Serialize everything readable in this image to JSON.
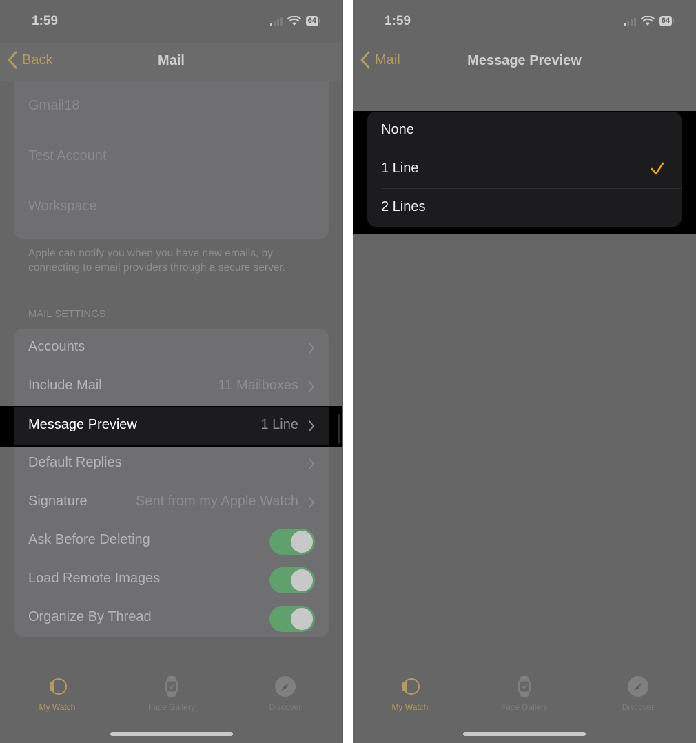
{
  "colors": {
    "accent": "#b59a62",
    "toggle_on": "#5fa06d",
    "checkmark": "#f0a020",
    "panel_bg": "#666666",
    "highlight_bg": "#1c1c1e"
  },
  "left": {
    "status": {
      "time": "1:59",
      "battery": "64"
    },
    "nav": {
      "back_label": "Back",
      "title": "Mail"
    },
    "accounts": [
      "Gmail18",
      "Test Account",
      "Workspace"
    ],
    "footer_note": "Apple can notify you when you have new emails, by connecting to email providers through a secure server.",
    "section_header": "MAIL SETTINGS",
    "settings": [
      {
        "label": "Accounts",
        "value": "",
        "type": "link"
      },
      {
        "label": "Include Mail",
        "value": "11 Mailboxes",
        "type": "link"
      },
      {
        "label": "Message Preview",
        "value": "1 Line",
        "type": "link",
        "highlighted": true
      },
      {
        "label": "Default Replies",
        "value": "",
        "type": "link"
      },
      {
        "label": "Signature",
        "value": "Sent from my Apple Watch",
        "type": "link"
      },
      {
        "label": "Ask Before Deleting",
        "type": "toggle",
        "on": true
      },
      {
        "label": "Load Remote Images",
        "type": "toggle",
        "on": true
      },
      {
        "label": "Organize By Thread",
        "type": "toggle",
        "on": true
      }
    ],
    "tabs": [
      {
        "label": "My Watch",
        "icon": "watch-side-icon",
        "active": true
      },
      {
        "label": "Face Gallery",
        "icon": "watch-face-icon",
        "active": false
      },
      {
        "label": "Discover",
        "icon": "compass-icon",
        "active": false
      }
    ]
  },
  "right": {
    "status": {
      "time": "1:59",
      "battery": "64"
    },
    "nav": {
      "back_label": "Mail",
      "title": "Message Preview"
    },
    "options": [
      {
        "label": "None",
        "selected": false
      },
      {
        "label": "1 Line",
        "selected": true
      },
      {
        "label": "2 Lines",
        "selected": false
      }
    ],
    "tabs": [
      {
        "label": "My Watch",
        "icon": "watch-side-icon",
        "active": true
      },
      {
        "label": "Face Gallery",
        "icon": "watch-face-icon",
        "active": false
      },
      {
        "label": "Discover",
        "icon": "compass-icon",
        "active": false
      }
    ]
  }
}
